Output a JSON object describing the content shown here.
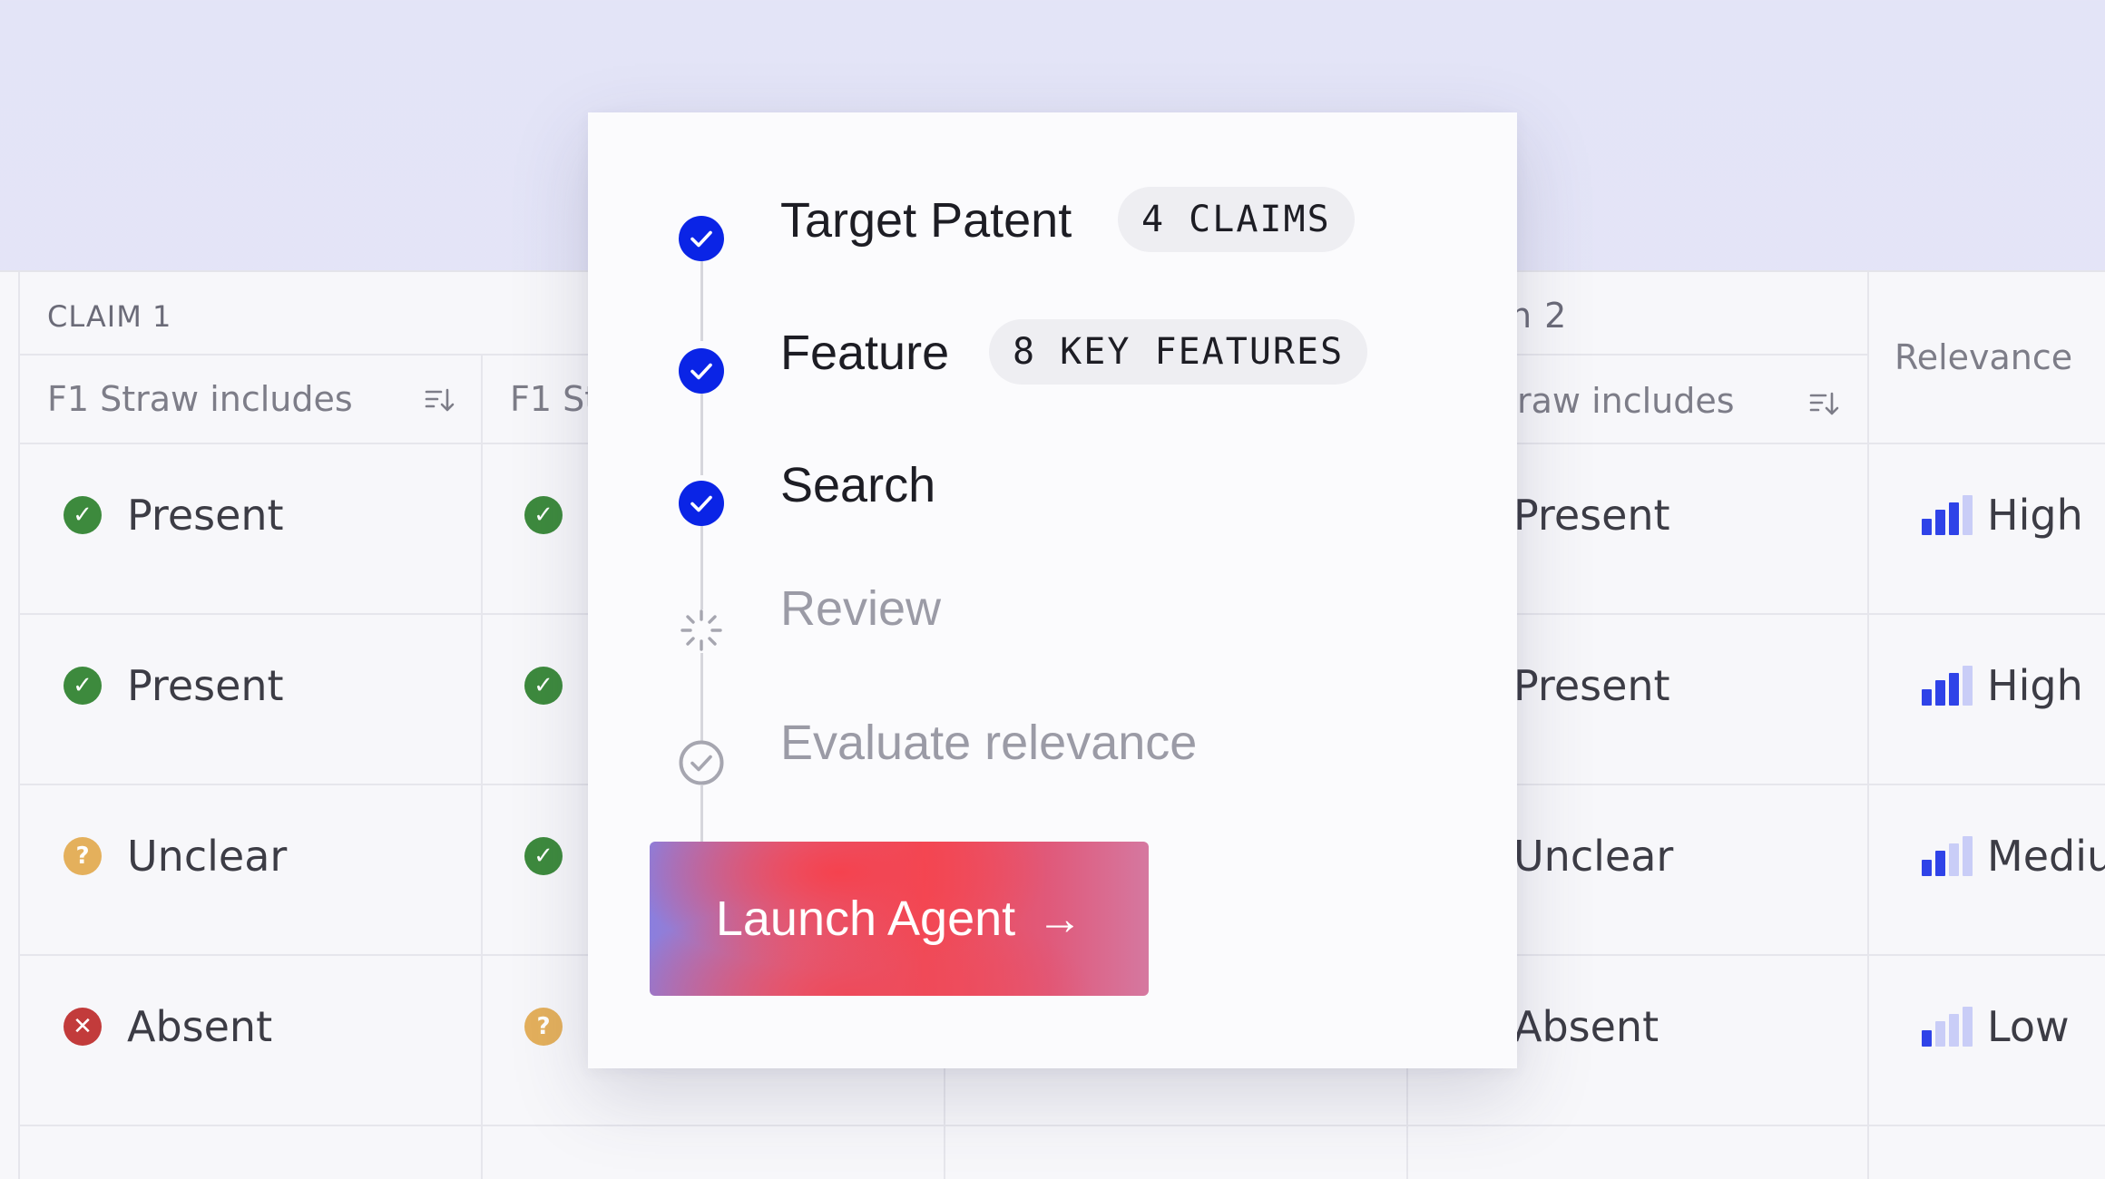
{
  "table": {
    "group_claim1": "CLAIM 1",
    "group_claim2_partial": "n 2",
    "col1_header": "F1 Straw includes",
    "col2_header_partial": "F1 St",
    "col4_header_partial": "raw includes",
    "relevance_header": "Relevance",
    "rows": [
      {
        "status1": "Present",
        "status1_type": "present",
        "status2_type": "present",
        "status4": "Present",
        "relevance": "High",
        "relevance_level": 4
      },
      {
        "status1": "Present",
        "status1_type": "present",
        "status2_type": "present",
        "status4": "Present",
        "relevance": "High",
        "relevance_level": 4
      },
      {
        "status1": "Unclear",
        "status1_type": "unclear",
        "status2_type": "present",
        "status4": "Unclear",
        "relevance": "Mediu",
        "relevance_level": 3
      },
      {
        "status1": "Absent",
        "status1_type": "absent",
        "status2_type": "unclear",
        "status4": "Absent",
        "relevance": "Low",
        "relevance_level": 2
      }
    ]
  },
  "steps": [
    {
      "label": "Target Patent",
      "state": "done",
      "pill": "4 CLAIMS"
    },
    {
      "label": "Feature",
      "state": "done",
      "pill": "8 KEY FEATURES"
    },
    {
      "label": "Search",
      "state": "done"
    },
    {
      "label": "Review",
      "state": "loading"
    },
    {
      "label": "Evaluate relevance",
      "state": "pending"
    }
  ],
  "launch_button": {
    "label": "Launch Agent",
    "arrow": "→"
  },
  "colors": {
    "step_done": "#0a24e6",
    "present": "#3d8a3d",
    "unclear": "#e4b05c",
    "absent": "#c23b3b",
    "bar_active": "#2f43e8",
    "bar_inactive": "#c9cdf7"
  }
}
